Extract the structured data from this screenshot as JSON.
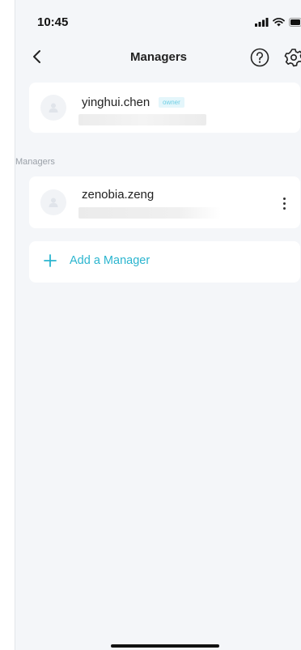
{
  "status_bar": {
    "time": "10:45",
    "icons": [
      "cellular-signal-icon",
      "wifi-icon",
      "battery-icon"
    ]
  },
  "nav": {
    "title": "Managers",
    "back_icon": "chevron-left-icon",
    "help_icon": "question-circle-icon",
    "settings_icon": "gear-icon"
  },
  "owner": {
    "name": "yinghui.chen",
    "badge": "owner",
    "avatar_icon": "user-avatar-icon"
  },
  "managers_section": {
    "label": "Managers",
    "items": [
      {
        "name": "zenobia.zeng",
        "avatar_icon": "user-avatar-icon",
        "menu_icon": "more-vertical-icon"
      }
    ]
  },
  "add_manager": {
    "label": "Add a Manager",
    "icon": "plus-icon"
  },
  "colors": {
    "accent": "#2bb5cf",
    "background": "#f4f6f9",
    "card": "#ffffff",
    "badge_bg": "#e4f6fb"
  }
}
